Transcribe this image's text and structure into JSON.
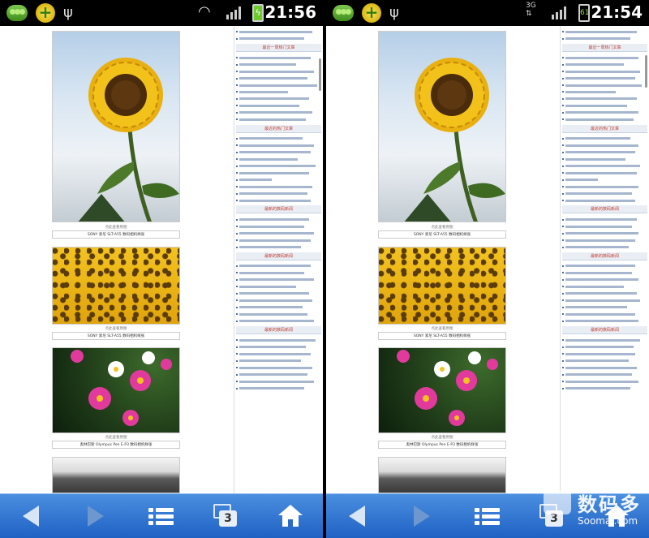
{
  "screens": [
    {
      "clock": "21:56",
      "network": "",
      "battery_label": "",
      "tab_count": "3"
    },
    {
      "clock": "21:54",
      "network": "3G",
      "battery_label": "61",
      "tab_count": "3"
    }
  ],
  "photo_captions": [
    {
      "line1": "点此查看原图",
      "line2": "SONY 索尼 SLT-A55 数码相机样张"
    },
    {
      "line1": "点此查看原图",
      "line2": "SONY 索尼 SLT-A55 数码相机样张"
    },
    {
      "line1": "点此查看原图",
      "line2": "奥林巴斯 Olympus Pen E-P3 数码相机样张"
    }
  ],
  "sidebar_headings": [
    "最近一周热门文章",
    "最近的热门文章",
    "最新的数码新闻",
    "最新的数码新闻",
    "最新的数码新闻"
  ],
  "watermark": {
    "cn": "数码多",
    "en": "Soomal.com"
  },
  "colors": {
    "toolbar": "#2a6ac8",
    "accent": "#4a6ea9"
  },
  "icons": [
    "pea-app-icon",
    "plus-app-icon",
    "usb-icon",
    "wifi-icon",
    "signal-icon",
    "battery-icon",
    "back-icon",
    "forward-icon",
    "menu-icon",
    "tabs-icon",
    "home-icon"
  ]
}
